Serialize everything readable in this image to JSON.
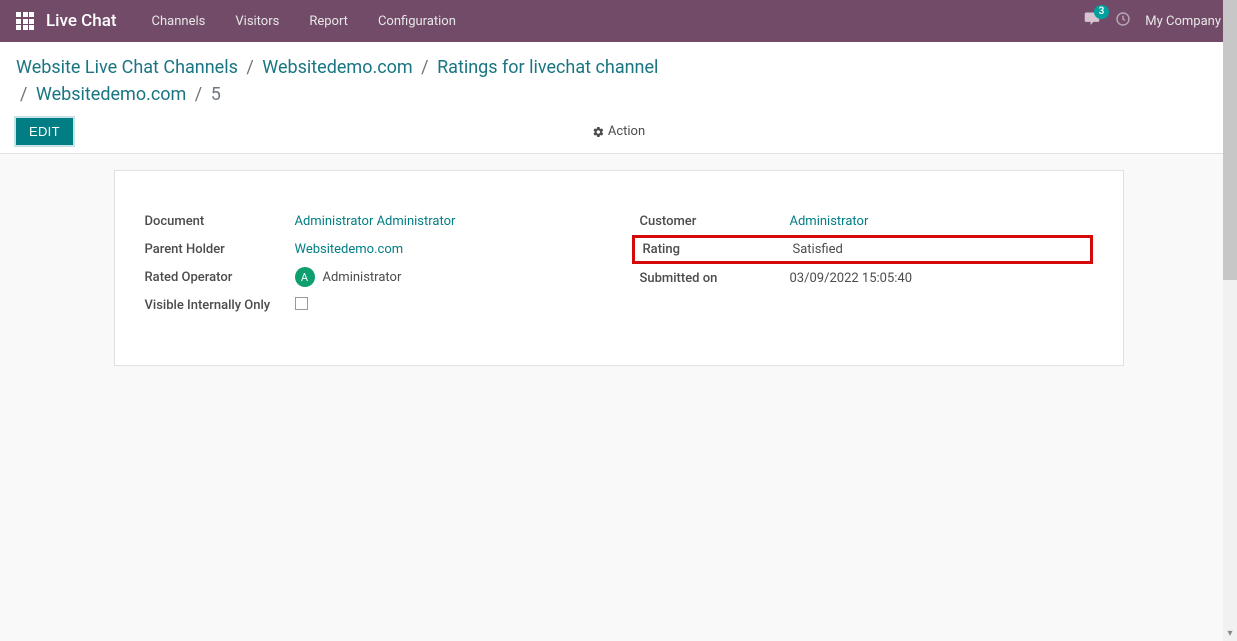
{
  "header": {
    "app_name": "Live Chat",
    "nav": {
      "channels": "Channels",
      "visitors": "Visitors",
      "report": "Report",
      "configuration": "Configuration"
    },
    "message_count": "3",
    "company": "My Company"
  },
  "breadcrumbs": {
    "b1": "Website Live Chat Channels",
    "b2": "Websitedemo.com",
    "b3": "Ratings for livechat channel",
    "b4": "Websitedemo.com",
    "b5": "5"
  },
  "controls": {
    "edit": "EDIT",
    "action": "Action"
  },
  "fields_left": {
    "document_label": "Document",
    "document_value": "Administrator Administrator",
    "parent_label": "Parent Holder",
    "parent_value": "Websitedemo.com",
    "operator_label": "Rated Operator",
    "operator_avatar": "A",
    "operator_value": "Administrator",
    "visible_label": "Visible Internally Only"
  },
  "fields_right": {
    "customer_label": "Customer",
    "customer_value": "Administrator",
    "rating_label": "Rating",
    "rating_value": "Satisfied",
    "submitted_label": "Submitted on",
    "submitted_value": "03/09/2022 15:05:40"
  }
}
